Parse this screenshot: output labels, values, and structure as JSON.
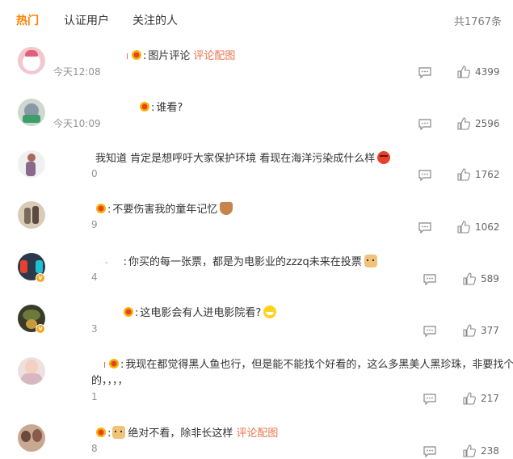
{
  "tabs": [
    {
      "label": "热门"
    },
    {
      "label": "认证用户"
    },
    {
      "label": "关注的人"
    }
  ],
  "total": "共1767条",
  "comments": [
    {
      "name_mark": "I",
      "text": "图片评论",
      "link": "评论配图",
      "time": "今天12:08",
      "likes": "4399"
    },
    {
      "text": "谁看?",
      "time": "今天10:09",
      "likes": "2596"
    },
    {
      "text": "我知道 肯定是想呼吁大家保护环境 看现在海洋污染成什么样",
      "emoji": "angry-icon",
      "time": "0",
      "likes": "1762"
    },
    {
      "text": "不要伤害我的童年记忆",
      "emoji": "shy-icon",
      "time": "9",
      "likes": "1062"
    },
    {
      "name_mark": "-",
      "text": "你买的每一张票，都是为电影业的zzzq未来在投票",
      "emoji": "doge-icon",
      "time": "4",
      "likes": "589"
    },
    {
      "text": "这电影会有人进电影院看?",
      "emoji": "laugh-icon",
      "time": "3",
      "likes": "377"
    },
    {
      "name_mark": "I",
      "text": "我现在都觉得黑人鱼也行，但是能不能找个好看的，这么多黑美人黑珍珠，非要找个",
      "text2": "的，，，，",
      "time": "1",
      "likes": "217"
    },
    {
      "text": "绝对不看，除非长这样",
      "link": "评论配图",
      "emoji": "doge-icon",
      "time": "8",
      "likes": "238"
    }
  ]
}
